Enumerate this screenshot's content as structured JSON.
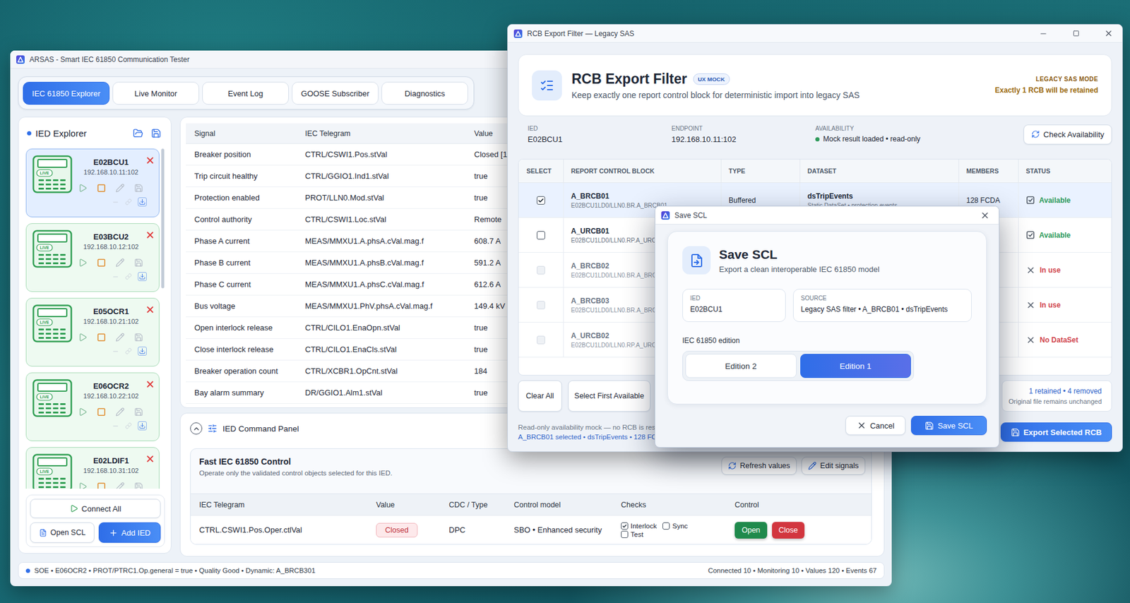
{
  "main_window": {
    "title": "ARSAS - Smart IEC 61850 Communication Tester",
    "tabs": [
      {
        "label": "IEC 61850 Explorer",
        "selected": true
      },
      {
        "label": "Live Monitor",
        "selected": false
      },
      {
        "label": "Event Log",
        "selected": false
      },
      {
        "label": "GOOSE Subscriber",
        "selected": false
      },
      {
        "label": "Diagnostics",
        "selected": false
      }
    ],
    "explorer": {
      "title": "IED Explorer",
      "ieds": [
        {
          "name": "E02BCU1",
          "address": "192.168.10.11:102",
          "badge": "LIVE",
          "selected": true
        },
        {
          "name": "E03BCU2",
          "address": "192.168.10.12:102",
          "badge": "LIVE",
          "selected": false
        },
        {
          "name": "E05OCR1",
          "address": "192.168.10.21:102",
          "badge": "LIVE",
          "selected": false
        },
        {
          "name": "E06OCR2",
          "address": "192.168.10.22:102",
          "badge": "LIVE",
          "selected": false
        },
        {
          "name": "E02LDIF1",
          "address": "192.168.10.31:102",
          "badge": "LIVE",
          "selected": false
        }
      ],
      "connect_all": "Connect All",
      "open_scl": "Open SCL",
      "add_ied": "Add IED"
    },
    "signals": {
      "columns": [
        "Signal",
        "IEC Telegram",
        "Value"
      ],
      "rows": [
        {
          "signal": "Breaker position",
          "telegram": "CTRL/CSWI1.Pos.stVal",
          "value": "Closed [1"
        },
        {
          "signal": "Trip circuit healthy",
          "telegram": "CTRL/GGIO1.Ind1.stVal",
          "value": "true"
        },
        {
          "signal": "Protection enabled",
          "telegram": "PROT/LLN0.Mod.stVal",
          "value": "true"
        },
        {
          "signal": "Control authority",
          "telegram": "CTRL/CSWI1.Loc.stVal",
          "value": "Remote"
        },
        {
          "signal": "Phase A current",
          "telegram": "MEAS/MMXU1.A.phsA.cVal.mag.f",
          "value": "608.7 A"
        },
        {
          "signal": "Phase B current",
          "telegram": "MEAS/MMXU1.A.phsB.cVal.mag.f",
          "value": "591.2 A"
        },
        {
          "signal": "Phase C current",
          "telegram": "MEAS/MMXU1.A.phsC.cVal.mag.f",
          "value": "612.6 A"
        },
        {
          "signal": "Bus voltage",
          "telegram": "MEAS/MMXU1.PhV.phsA.cVal.mag.f",
          "value": "149.4 kV"
        },
        {
          "signal": "Open interlock release",
          "telegram": "CTRL/CILO1.EnaOpn.stVal",
          "value": "true"
        },
        {
          "signal": "Close interlock release",
          "telegram": "CTRL/CILO1.EnaCls.stVal",
          "value": "true"
        },
        {
          "signal": "Breaker operation count",
          "telegram": "CTRL/XCBR1.OpCnt.stVal",
          "value": "184"
        },
        {
          "signal": "Bay alarm summary",
          "telegram": "DR/GGIO1.Alm1.stVal",
          "value": "true"
        }
      ]
    },
    "command_panel": {
      "title": "IED Command Panel",
      "card_title": "Fast IEC 61850 Control",
      "card_subtitle": "Operate only the validated control objects selected for this IED.",
      "refresh": "Refresh values",
      "edit": "Edit signals",
      "columns": [
        "IEC Telegram",
        "Value",
        "CDC / Type",
        "Control model",
        "Checks",
        "Control"
      ],
      "rows": [
        {
          "telegram": "CTRL.CSWI1.Pos.Oper.ctlVal",
          "value": "Closed",
          "cdc": "DPC",
          "model": "SBO • Enhanced security",
          "checks": [
            {
              "label": "Interlock",
              "checked": true
            },
            {
              "label": "Sync",
              "checked": false
            },
            {
              "label": "Test",
              "checked": false
            }
          ],
          "actions": [
            {
              "label": "Open",
              "color": "#1f8a4c"
            },
            {
              "label": "Close",
              "color": "#d2363f"
            }
          ]
        }
      ]
    },
    "status_bar": {
      "left": "SOE • E06OCR2 • PROT/PTRC1.Op.general = true • Quality Good • Dynamic: A_BRCB301",
      "right": "Connected 10 • Monitoring 10 • Values 120 • Events 67"
    }
  },
  "rcb_window": {
    "title": "RCB Export Filter — Legacy SAS",
    "heading": "RCB Export Filter",
    "badge": "UX MOCK",
    "subtitle": "Keep exactly one report control block for deterministic import into legacy SAS",
    "mode": "LEGACY SAS MODE",
    "mode_note": "Exactly 1 RCB will be retained",
    "info": [
      {
        "label": "IED",
        "value": "E02BCU1"
      },
      {
        "label": "ENDPOINT",
        "value": "192.168.10.11:102"
      },
      {
        "label": "AVAILABILITY",
        "value": "Mock result loaded • read-only",
        "color": "#2e9a5a"
      }
    ],
    "check_button": "Check Availability",
    "columns": [
      "SELECT",
      "REPORT CONTROL BLOCK",
      "TYPE",
      "DATASET",
      "MEMBERS",
      "STATUS"
    ],
    "rows": [
      {
        "name": "A_BRCB01",
        "path": "E02BCU1LD0/LLN0.BR.A_BRCB01",
        "type": "Buffered",
        "dataset": "dsTripEvents",
        "dataset_note": "Static DataSet • protection events",
        "members": "128 FCDA",
        "status": "Available",
        "available": true,
        "checked": true,
        "disabled": false,
        "selected": true,
        "color": "#2e9a5a"
      },
      {
        "name": "A_URCB01",
        "path": "E02BCU1LD0/LLN0.RP.A_URCB01",
        "status": "Available",
        "available": true,
        "checked": false,
        "disabled": false,
        "selected": false,
        "color": "#2e9a5a"
      },
      {
        "name": "A_BRCB02",
        "path": "E02BCU1LD0/LLN0.BR.A_BRCB02",
        "status": "In use",
        "available": false,
        "checked": false,
        "disabled": true,
        "selected": false,
        "color": "#d0454c"
      },
      {
        "name": "A_BRCB03",
        "path": "E02BCU1LD0/LLN0.BR.A_BRCB03",
        "status": "In use",
        "available": false,
        "checked": false,
        "disabled": true,
        "selected": false,
        "color": "#d0454c"
      },
      {
        "name": "A_URCB02",
        "path": "E02BCU1LD0/LLN0.RP.A_URCB02",
        "status": "No DataSet",
        "available": false,
        "checked": false,
        "disabled": true,
        "selected": false,
        "color": "#d0454c"
      }
    ],
    "clear": "Clear All",
    "select_first": "Select First Available",
    "note": "Read-only availability mock — no RCB is reser",
    "selection_note": "A_BRCB01 selected • dsTripEvents • 128 FCDA.",
    "summary": "1 retained • 4 removed",
    "summary_note": "Original file remains unchanged",
    "export": "Export Selected RCB"
  },
  "save_dialog": {
    "title": "Save SCL",
    "heading": "Save SCL",
    "subtitle": "Export a clean interoperable IEC 61850 model",
    "fields": [
      {
        "label": "IED",
        "value": "E02BCU1"
      },
      {
        "label": "SOURCE",
        "value": "Legacy SAS filter • A_BRCB01 • dsTripEvents"
      }
    ],
    "edition_label": "IEC 61850 edition",
    "editions": [
      {
        "label": "Edition 2",
        "selected": false
      },
      {
        "label": "Edition 1",
        "selected": true
      }
    ],
    "cancel": "Cancel",
    "save": "Save SCL"
  }
}
